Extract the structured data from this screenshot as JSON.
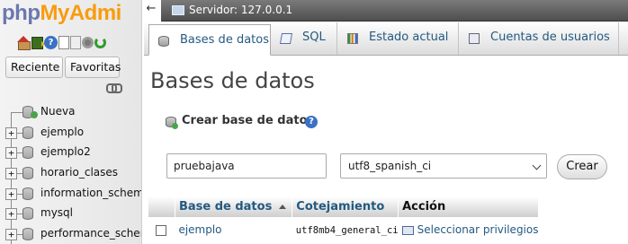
{
  "nav": {
    "logo_php": "php",
    "logo_my": "MyAdmi",
    "recent_label": "Reciente",
    "favorites_label": "Favoritas",
    "tree": [
      {
        "label": "Nueva",
        "type": "new"
      },
      {
        "label": "ejemplo",
        "type": "db"
      },
      {
        "label": "ejemplo2",
        "type": "db"
      },
      {
        "label": "horario_clases",
        "type": "db"
      },
      {
        "label": "information_schema",
        "type": "db"
      },
      {
        "label": "mysql",
        "type": "db"
      },
      {
        "label": "performance_schema",
        "type": "db"
      }
    ]
  },
  "topbar": {
    "collapse_glyph": "←",
    "server_label": "Servidor: 127.0.0.1"
  },
  "tabs": [
    {
      "label": "Bases de datos",
      "icon": "database-icon",
      "active": true
    },
    {
      "label": "SQL",
      "icon": "sql-icon",
      "active": false
    },
    {
      "label": "Estado actual",
      "icon": "status-chart-icon",
      "active": false
    },
    {
      "label": "Cuentas de usuarios",
      "icon": "users-icon",
      "active": false
    }
  ],
  "main": {
    "title": "Bases de datos",
    "create_label": "Crear base de datos",
    "help_glyph": "?",
    "dbname_value": "pruebajava",
    "collation_value": "utf8_spanish_ci",
    "create_button": "Crear",
    "table": {
      "headers": [
        "Base de datos",
        "Cotejamiento",
        "Acción"
      ],
      "rows": [
        {
          "name": "ejemplo",
          "collation": "utf8mb4_general_ci",
          "action": "Seleccionar privilegios"
        }
      ]
    }
  },
  "colors": {
    "link": "#235a81",
    "logo_php": "#6c78af",
    "logo_my": "#f89c0e"
  }
}
